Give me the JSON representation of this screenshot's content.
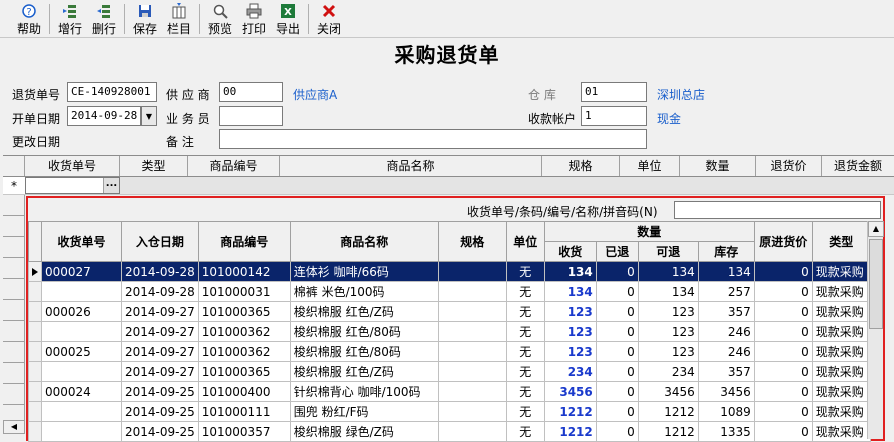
{
  "toolbar": {
    "buttons": [
      {
        "label": "帮助",
        "icon": "help-icon"
      },
      {
        "label": "增行",
        "icon": "add-row-icon"
      },
      {
        "label": "删行",
        "icon": "delete-row-icon"
      },
      {
        "label": "保存",
        "icon": "save-icon"
      },
      {
        "label": "栏目",
        "icon": "columns-icon"
      },
      {
        "label": "预览",
        "icon": "preview-icon"
      },
      {
        "label": "打印",
        "icon": "print-icon"
      },
      {
        "label": "导出",
        "icon": "export-icon"
      },
      {
        "label": "关闭",
        "icon": "close-icon"
      }
    ]
  },
  "title": "采购退货单",
  "form": {
    "return_no_label": "退货单号",
    "return_no_value": "CE-140928001",
    "supplier_label": "供 应 商",
    "supplier_value": "00",
    "supplier_name": "供应商A",
    "warehouse_label": "仓    库",
    "warehouse_value": "01",
    "warehouse_name": "深圳总店",
    "open_date_label": "开单日期",
    "open_date_value": "2014-09-28",
    "salesman_label": "业 务 员",
    "salesman_value": "",
    "account_label": "收款帐户",
    "account_value": "1",
    "account_name": "现金",
    "modify_date_label": "更改日期",
    "remark_label": "备    注",
    "remark_value": ""
  },
  "grid": {
    "headers": [
      "收货单号",
      "类型",
      "商品编号",
      "商品名称",
      "规格",
      "单位",
      "数量",
      "退货价",
      "退货金额"
    ],
    "new_row_marker": "*",
    "ellipsis": "..."
  },
  "popup": {
    "search_label": "收货单号/条码/编号/名称/拼音码(N)",
    "search_value": "",
    "headers": {
      "receipt_no": "收货单号",
      "in_date": "入仓日期",
      "item_code": "商品编号",
      "item_name": "商品名称",
      "spec": "规格",
      "unit": "单位",
      "qty_group": "数量",
      "received": "收货",
      "returned": "已退",
      "returnable": "可退",
      "stock": "库存",
      "orig_price": "原进货价",
      "type": "类型"
    },
    "rows": [
      {
        "receipt_no": "000027",
        "in_date": "2014-09-28",
        "item_code": "101000142",
        "item_name": "连体衫  咖啡/66码",
        "spec": "",
        "unit": "无",
        "received": "134",
        "returned": "0",
        "returnable": "134",
        "stock": "134",
        "orig_price": "0",
        "type": "现款采购"
      },
      {
        "receipt_no": "",
        "in_date": "2014-09-28",
        "item_code": "101000031",
        "item_name": "棉裤  米色/100码",
        "spec": "",
        "unit": "无",
        "received": "134",
        "returned": "0",
        "returnable": "134",
        "stock": "257",
        "orig_price": "0",
        "type": "现款采购"
      },
      {
        "receipt_no": "000026",
        "in_date": "2014-09-27",
        "item_code": "101000365",
        "item_name": "梭织棉服  红色/Z码",
        "spec": "",
        "unit": "无",
        "received": "123",
        "returned": "0",
        "returnable": "123",
        "stock": "357",
        "orig_price": "0",
        "type": "现款采购"
      },
      {
        "receipt_no": "",
        "in_date": "2014-09-27",
        "item_code": "101000362",
        "item_name": "梭织棉服  红色/80码",
        "spec": "",
        "unit": "无",
        "received": "123",
        "returned": "0",
        "returnable": "123",
        "stock": "246",
        "orig_price": "0",
        "type": "现款采购"
      },
      {
        "receipt_no": "000025",
        "in_date": "2014-09-27",
        "item_code": "101000362",
        "item_name": "梭织棉服  红色/80码",
        "spec": "",
        "unit": "无",
        "received": "123",
        "returned": "0",
        "returnable": "123",
        "stock": "246",
        "orig_price": "0",
        "type": "现款采购"
      },
      {
        "receipt_no": "",
        "in_date": "2014-09-27",
        "item_code": "101000365",
        "item_name": "梭织棉服  红色/Z码",
        "spec": "",
        "unit": "无",
        "received": "234",
        "returned": "0",
        "returnable": "234",
        "stock": "357",
        "orig_price": "0",
        "type": "现款采购"
      },
      {
        "receipt_no": "000024",
        "in_date": "2014-09-25",
        "item_code": "101000400",
        "item_name": "针织棉背心  咖啡/100码",
        "spec": "",
        "unit": "无",
        "received": "3456",
        "returned": "0",
        "returnable": "3456",
        "stock": "3456",
        "orig_price": "0",
        "type": "现款采购"
      },
      {
        "receipt_no": "",
        "in_date": "2014-09-25",
        "item_code": "101000111",
        "item_name": "围兜  粉红/F码",
        "spec": "",
        "unit": "无",
        "received": "1212",
        "returned": "0",
        "returnable": "1212",
        "stock": "1089",
        "orig_price": "0",
        "type": "现款采购"
      },
      {
        "receipt_no": "",
        "in_date": "2014-09-25",
        "item_code": "101000357",
        "item_name": "梭织棉服  绿色/Z码",
        "spec": "",
        "unit": "无",
        "received": "1212",
        "returned": "0",
        "returnable": "1212",
        "stock": "1335",
        "orig_price": "0",
        "type": "现款采购"
      }
    ],
    "selected_row": 0
  },
  "colors": {
    "selection": "#0a246a",
    "link": "#1a5fcc",
    "popup_border": "#e02020",
    "qty_blue": "#1a3acc"
  }
}
